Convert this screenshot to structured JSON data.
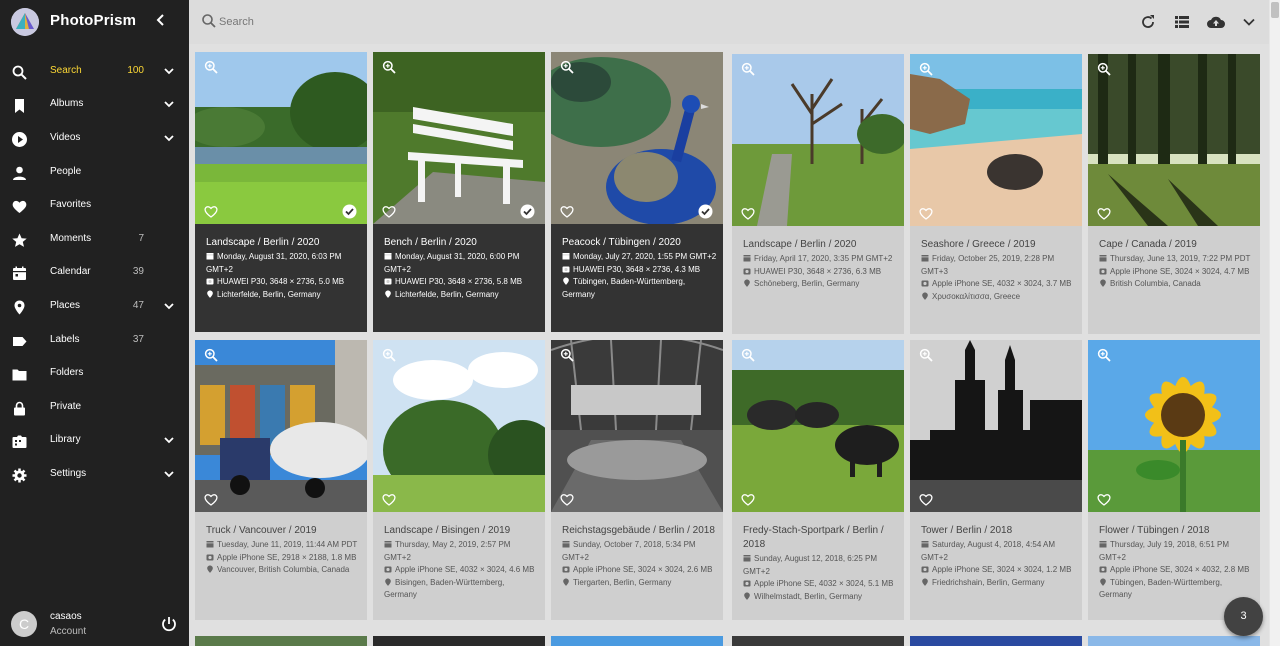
{
  "app": {
    "name": "PhotoPrism"
  },
  "nav": [
    {
      "label": "Search",
      "count": "100",
      "icon": "search-icon",
      "chevron": true,
      "active": true
    },
    {
      "label": "Albums",
      "count": "",
      "icon": "bookmark-icon",
      "chevron": true
    },
    {
      "label": "Videos",
      "count": "",
      "icon": "play-circle-icon",
      "chevron": true
    },
    {
      "label": "People",
      "count": "",
      "icon": "person-icon",
      "chevron": false
    },
    {
      "label": "Favorites",
      "count": "",
      "icon": "heart-icon",
      "chevron": false
    },
    {
      "label": "Moments",
      "count": "7",
      "icon": "star-icon",
      "chevron": false
    },
    {
      "label": "Calendar",
      "count": "39",
      "icon": "calendar-icon",
      "chevron": false
    },
    {
      "label": "Places",
      "count": "47",
      "icon": "place-icon",
      "chevron": true
    },
    {
      "label": "Labels",
      "count": "37",
      "icon": "label-icon",
      "chevron": false
    },
    {
      "label": "Folders",
      "count": "",
      "icon": "folder-icon",
      "chevron": false
    },
    {
      "label": "Private",
      "count": "",
      "icon": "lock-icon",
      "chevron": false
    },
    {
      "label": "Library",
      "count": "",
      "icon": "library-icon",
      "chevron": true
    },
    {
      "label": "Settings",
      "count": "",
      "icon": "gear-icon",
      "chevron": true
    }
  ],
  "user": {
    "initial": "C",
    "name": "casaos",
    "role": "Account"
  },
  "search": {
    "placeholder": "Search"
  },
  "toolbar": [
    "refresh-icon",
    "list-view-icon",
    "upload-icon",
    "chevron-down-icon"
  ],
  "selection_count": "3",
  "colors": {
    "sidebar": "#212121",
    "accent": "#fdd835",
    "card": "#cfcfcf",
    "card_selected": "#333333"
  },
  "photos": [
    {
      "title": "Landscape / Berlin / 2020",
      "date": "Monday, August 31, 2020, 6:03 PM GMT+2",
      "camera": "HUAWEI P30, 3648 × 2736, 5.0 MB",
      "location": "Lichterfelde, Berlin, Germany",
      "selected": true,
      "scene": "landscape"
    },
    {
      "title": "Bench / Berlin / 2020",
      "date": "Monday, August 31, 2020, 6:00 PM GMT+2",
      "camera": "HUAWEI P30, 3648 × 2736, 5.8 MB",
      "location": "Lichterfelde, Berlin, Germany",
      "selected": true,
      "scene": "bench"
    },
    {
      "title": "Peacock / Tübingen / 2020",
      "date": "Monday, July 27, 2020, 1:55 PM GMT+2",
      "camera": "HUAWEI P30, 3648 × 2736, 4.3 MB",
      "location": "Tübingen, Baden-Württemberg, Germany",
      "selected": true,
      "scene": "peacock"
    },
    {
      "title": "Landscape / Berlin / 2020",
      "date": "Friday, April 17, 2020, 3:35 PM GMT+2",
      "camera": "HUAWEI P30, 3648 × 2736, 6.3 MB",
      "location": "Schöneberg, Berlin, Germany",
      "selected": false,
      "scene": "garden"
    },
    {
      "title": "Seashore / Greece / 2019",
      "date": "Friday, October 25, 2019, 2:28 PM GMT+3",
      "camera": "Apple iPhone SE, 4032 × 3024, 3.7 MB",
      "location": "Χρυσοκαλίτισσα, Greece",
      "selected": false,
      "scene": "sea"
    },
    {
      "title": "Cape / Canada / 2019",
      "date": "Thursday, June 13, 2019, 7:22 PM PDT",
      "camera": "Apple iPhone SE, 3024 × 3024, 4.7 MB",
      "location": "British Columbia, Canada",
      "selected": false,
      "scene": "forest"
    },
    {
      "title": "Truck / Vancouver / 2019",
      "date": "Tuesday, June 11, 2019, 11:44 AM PDT",
      "camera": "Apple iPhone SE, 2918 × 2188, 1.8 MB",
      "location": "Vancouver, British Columbia, Canada",
      "selected": false,
      "scene": "truck"
    },
    {
      "title": "Landscape / Bisingen / 2019",
      "date": "Thursday, May 2, 2019, 2:57 PM GMT+2",
      "camera": "Apple iPhone SE, 4032 × 3024, 4.6 MB",
      "location": "Bisingen, Baden-Württemberg, Germany",
      "selected": false,
      "scene": "meadow"
    },
    {
      "title": "Reichstagsgebäude / Berlin / 2018",
      "date": "Sunday, October 7, 2018, 5:34 PM GMT+2",
      "camera": "Apple iPhone SE, 3024 × 3024, 2.6 MB",
      "location": "Tiergarten, Berlin, Germany",
      "selected": false,
      "scene": "dome"
    },
    {
      "title": "Fredy-Stach-Sportpark / Berlin / 2018",
      "date": "Sunday, August 12, 2018, 6:25 PM GMT+2",
      "camera": "Apple iPhone SE, 4032 × 3024, 5.1 MB",
      "location": "Wilhelmstadt, Berlin, Germany",
      "selected": false,
      "scene": "buffalo"
    },
    {
      "title": "Tower / Berlin / 2018",
      "date": "Saturday, August 4, 2018, 4:54 AM GMT+2",
      "camera": "Apple iPhone SE, 3024 × 3024, 1.2 MB",
      "location": "Friedrichshain, Berlin, Germany",
      "selected": false,
      "scene": "tower"
    },
    {
      "title": "Flower / Tübingen / 2018",
      "date": "Thursday, July 19, 2018, 6:51 PM GMT+2",
      "camera": "Apple iPhone SE, 3024 × 4032, 2.8 MB",
      "location": "Tübingen, Baden-Württemberg, Germany",
      "selected": false,
      "scene": "flower"
    }
  ]
}
